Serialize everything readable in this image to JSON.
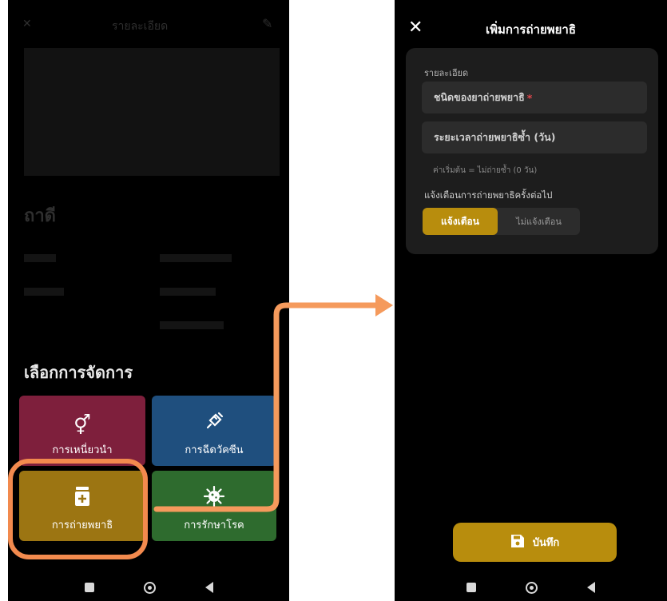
{
  "left_screen": {
    "dim_header_title": "รายละเอียด",
    "dim_animal_name": "ถาดี",
    "sheet_title": "เลือกการจัดการ",
    "tiles": [
      {
        "label": "การเหนี่ยวนำ",
        "icon": "gender-symbols-icon",
        "color": "#7e1f3c"
      },
      {
        "label": "การฉีดวัคซีน",
        "icon": "syringe-icon",
        "color": "#1f4f7e"
      },
      {
        "label": "การถ่ายพยาธิ",
        "icon": "medicine-bottle-icon",
        "color": "#9c7512"
      },
      {
        "label": "การรักษาโรค",
        "icon": "virus-icon",
        "color": "#2e6b2e"
      }
    ]
  },
  "right_screen": {
    "title": "เพิ่มการถ่ายพยาธิ",
    "section_label": "รายละเอียด",
    "dewormer_type_placeholder": "ชนิดของยาถ่ายพยาธิ",
    "required_mark": "*",
    "repeat_interval_placeholder": "ระยะเวลาถ่ายพยาธิซ้ำ (วัน)",
    "interval_hint": "ค่าเริ่มต้น = ไม่ถ่ายซ้ำ (0 วัน)",
    "notify_label": "แจ้งเตือนการถ่ายพยาธิครั้งต่อไป",
    "notify_on": "แจ้งเตือน",
    "notify_off": "ไม่แจ้งเตือน",
    "save_label": "บันทึก"
  },
  "colors": {
    "accent": "#b88d0d",
    "highlight": "#f28a4e",
    "arrow": "#f59a5c"
  }
}
